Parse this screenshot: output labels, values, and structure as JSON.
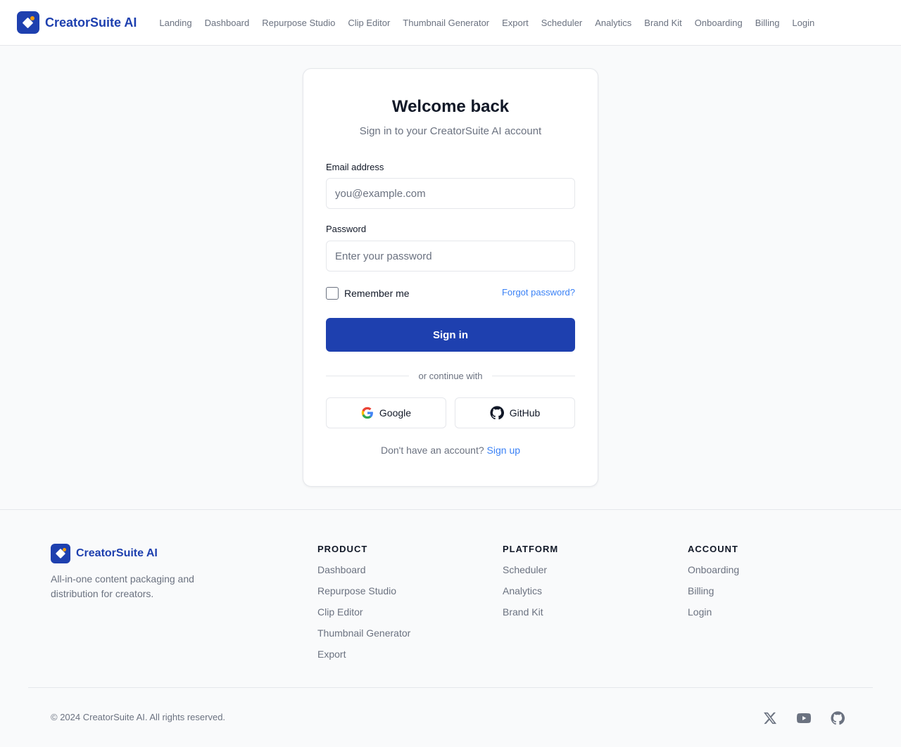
{
  "header": {
    "brand": "CreatorSuite AI",
    "nav": [
      "Landing",
      "Dashboard",
      "Repurpose Studio",
      "Clip Editor",
      "Thumbnail Generator",
      "Export",
      "Scheduler",
      "Analytics",
      "Brand Kit",
      "Onboarding",
      "Billing",
      "Login"
    ]
  },
  "login": {
    "title": "Welcome back",
    "subtitle": "Sign in to your CreatorSuite AI account",
    "email_label": "Email address",
    "email_placeholder": "you@example.com",
    "email_value": "",
    "password_label": "Password",
    "password_placeholder": "Enter your password",
    "password_value": "",
    "remember_label": "Remember me",
    "remember_checked": false,
    "forgot_label": "Forgot password?",
    "submit_label": "Sign in",
    "divider_text": "or continue with",
    "google_label": "Google",
    "github_label": "GitHub",
    "signup_prompt": "Don't have an account?",
    "signup_link": "Sign up"
  },
  "footer": {
    "brand": "CreatorSuite AI",
    "tagline": "All-in-one content packaging and distribution for creators.",
    "columns": [
      {
        "heading": "PRODUCT",
        "links": [
          "Dashboard",
          "Repurpose Studio",
          "Clip Editor",
          "Thumbnail Generator",
          "Export"
        ]
      },
      {
        "heading": "PLATFORM",
        "links": [
          "Scheduler",
          "Analytics",
          "Brand Kit"
        ]
      },
      {
        "heading": "ACCOUNT",
        "links": [
          "Onboarding",
          "Billing",
          "Login"
        ]
      }
    ],
    "copyright": "© 2024 CreatorSuite AI. All rights reserved.",
    "social_icons": [
      "x-icon",
      "youtube-icon",
      "github-icon"
    ]
  },
  "colors": {
    "primary": "#1e40af",
    "accent": "#f59e0b",
    "link": "#3b82f6",
    "text_muted": "#6b7280",
    "border": "#e5e7eb",
    "background": "#f9fafb"
  }
}
